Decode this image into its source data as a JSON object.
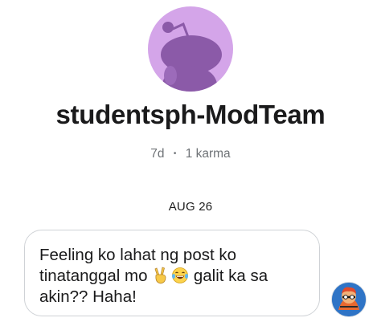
{
  "profile": {
    "avatar_icon": "reddit-snoo-icon",
    "avatar_bg_color": "#d4a5e9",
    "username": "studentsph-ModTeam",
    "age": "7d",
    "separator": "•",
    "karma": "1 karma"
  },
  "conversation": {
    "date_divider": "AUG 26",
    "message": {
      "line1": "Feeling ko lahat ng post ko",
      "line2_start": "tinatanggal mo ",
      "emoji_1": "victory-hand-icon",
      "emoji_2": "tears-of-joy-icon",
      "line2_end": " galit ka sa",
      "line3": "akin?? Haha!",
      "sender_avatar": "user-avatar-icon"
    }
  }
}
